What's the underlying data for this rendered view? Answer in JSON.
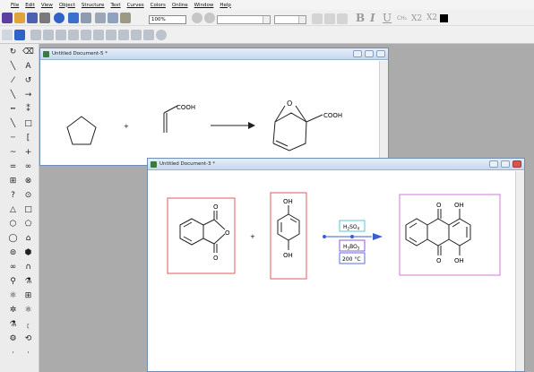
{
  "menu": [
    "File",
    "Edit",
    "View",
    "Object",
    "Structure",
    "Text",
    "Curves",
    "Colors",
    "Online",
    "Window",
    "Help"
  ],
  "toolbar": {
    "zoom": "100%"
  },
  "format_buttons": {
    "bold": "B",
    "italic": "I",
    "underline": "U",
    "subscript": "X2",
    "superscript": "X2"
  },
  "windows": {
    "doc5": {
      "title": "Untitled Document-5 *"
    },
    "doc3": {
      "title": "Untitled Document-3 *"
    }
  },
  "scheme5": {
    "plus": "+",
    "acid_label": "COOH",
    "product_o": "O",
    "product_acid": "COOH"
  },
  "scheme3": {
    "plus": "+",
    "anhydride_o1": "O",
    "anhydride_o2": "O",
    "anhydride_o3": "O",
    "hq_top": "OH",
    "hq_bottom": "OH",
    "reagent1_main": "H",
    "reagent1_sub1": "2",
    "reagent1_mid": "SO",
    "reagent1_sub2": "4",
    "reagent2_main": "H",
    "reagent2_sub1": "3",
    "reagent2_mid": "BO",
    "reagent2_sub2": "3",
    "condition": "200 °C",
    "prod_o_top": "O",
    "prod_o_bottom": "O",
    "prod_oh_top": "OH",
    "prod_oh_bottom": "OH"
  }
}
